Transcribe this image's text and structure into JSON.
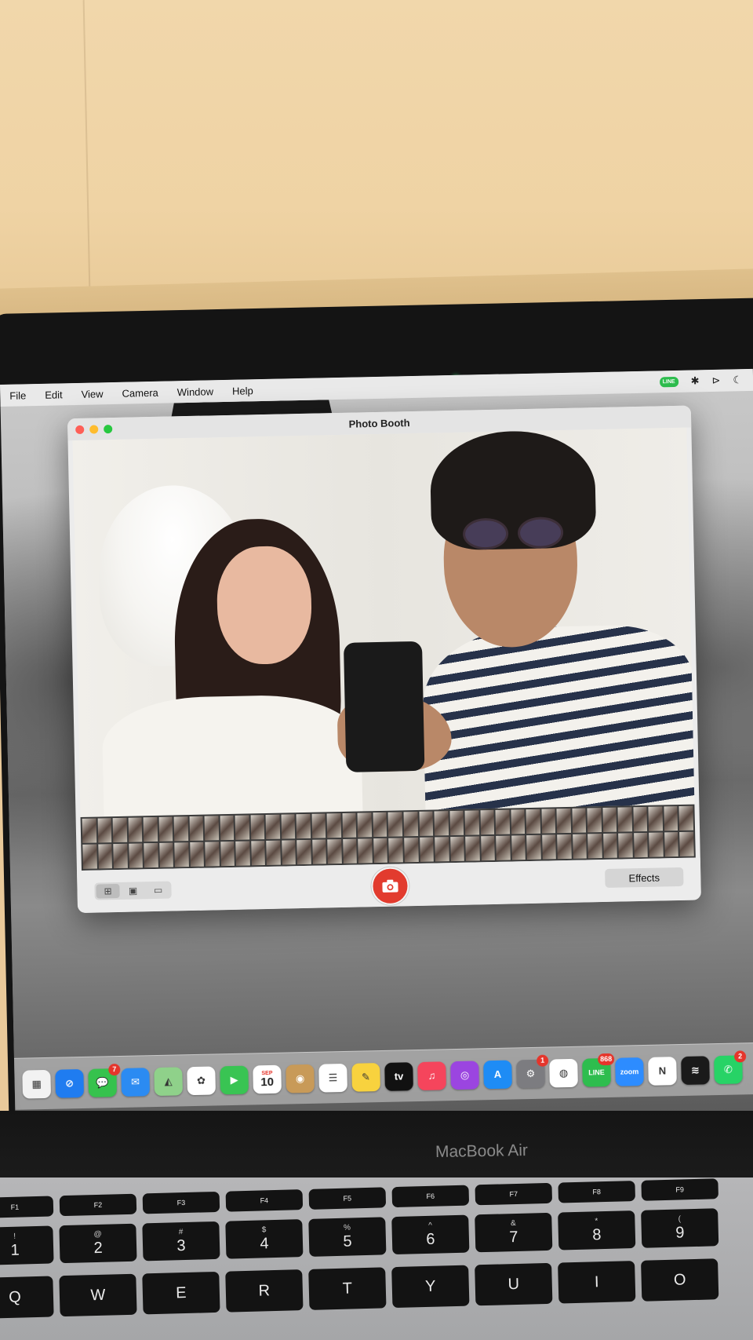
{
  "menubar": {
    "items": [
      "File",
      "Edit",
      "View",
      "Camera",
      "Window",
      "Help"
    ],
    "status": {
      "line_label": "LINE"
    }
  },
  "window": {
    "title": "Photo Booth",
    "effects_label": "Effects",
    "modes": [
      "grid-mode",
      "single-photo-mode",
      "video-mode"
    ]
  },
  "dock": {
    "apps": [
      {
        "name": "launchpad",
        "color": "#f2f2f2",
        "glyph": "▦",
        "badge": ""
      },
      {
        "name": "safari",
        "color": "#1f7cf0",
        "glyph": "⊘",
        "badge": ""
      },
      {
        "name": "messages",
        "color": "#36c24d",
        "glyph": "💬",
        "badge": "7"
      },
      {
        "name": "mail",
        "color": "#2b8bf2",
        "glyph": "✉",
        "badge": ""
      },
      {
        "name": "maps",
        "color": "#8fd18a",
        "glyph": "◭",
        "badge": ""
      },
      {
        "name": "photos",
        "color": "#ffffff",
        "glyph": "✿",
        "badge": ""
      },
      {
        "name": "facetime",
        "color": "#39c453",
        "glyph": "▶",
        "badge": ""
      },
      {
        "name": "calendar",
        "color": "#ffffff",
        "month": "SEP",
        "day": "10",
        "badge": ""
      },
      {
        "name": "contacts",
        "color": "#c89a58",
        "glyph": "◉",
        "badge": ""
      },
      {
        "name": "reminders",
        "color": "#ffffff",
        "glyph": "☰",
        "badge": ""
      },
      {
        "name": "notes",
        "color": "#f8d23e",
        "glyph": "✎",
        "badge": ""
      },
      {
        "name": "apple-tv",
        "color": "#111111",
        "glyph": "tv",
        "badge": ""
      },
      {
        "name": "music",
        "color": "#f5455c",
        "glyph": "♫",
        "badge": ""
      },
      {
        "name": "podcasts",
        "color": "#9b45e0",
        "glyph": "◎",
        "badge": ""
      },
      {
        "name": "app-store",
        "color": "#1e8cf5",
        "glyph": "A",
        "badge": ""
      },
      {
        "name": "system-settings",
        "color": "#7c7c80",
        "glyph": "⚙",
        "badge": "1"
      },
      {
        "name": "chrome",
        "color": "#ffffff",
        "glyph": "◍",
        "badge": ""
      },
      {
        "name": "line",
        "color": "#2ebd4e",
        "glyph": "LINE",
        "badge": "868"
      },
      {
        "name": "zoom",
        "color": "#2d8cff",
        "glyph": "zoom",
        "badge": ""
      },
      {
        "name": "notion",
        "color": "#ffffff",
        "glyph": "N",
        "badge": ""
      },
      {
        "name": "spotify",
        "color": "#1a1a1a",
        "glyph": "≋",
        "badge": ""
      },
      {
        "name": "whatsapp",
        "color": "#27d366",
        "glyph": "✆",
        "badge": "2"
      }
    ]
  },
  "laptop": {
    "model": "MacBook Air"
  },
  "keyboard": {
    "fn_row": [
      "F1",
      "F2",
      "F3",
      "F4",
      "F5",
      "F6",
      "F7",
      "F8",
      "F9"
    ],
    "num_row": [
      {
        "top": "!",
        "main": "1"
      },
      {
        "top": "@",
        "main": "2"
      },
      {
        "top": "#",
        "main": "3"
      },
      {
        "top": "$",
        "main": "4"
      },
      {
        "top": "%",
        "main": "5"
      },
      {
        "top": "^",
        "main": "6"
      },
      {
        "top": "&",
        "main": "7"
      },
      {
        "top": "*",
        "main": "8"
      },
      {
        "top": "(",
        "main": "9"
      }
    ],
    "letter_row": [
      "Q",
      "W",
      "E",
      "R",
      "T",
      "Y",
      "U",
      "I",
      "O"
    ]
  },
  "colors": {
    "shutter": "#e23b2e",
    "close": "#fe5f57",
    "minimize": "#febc2e",
    "zoom": "#28c840"
  }
}
